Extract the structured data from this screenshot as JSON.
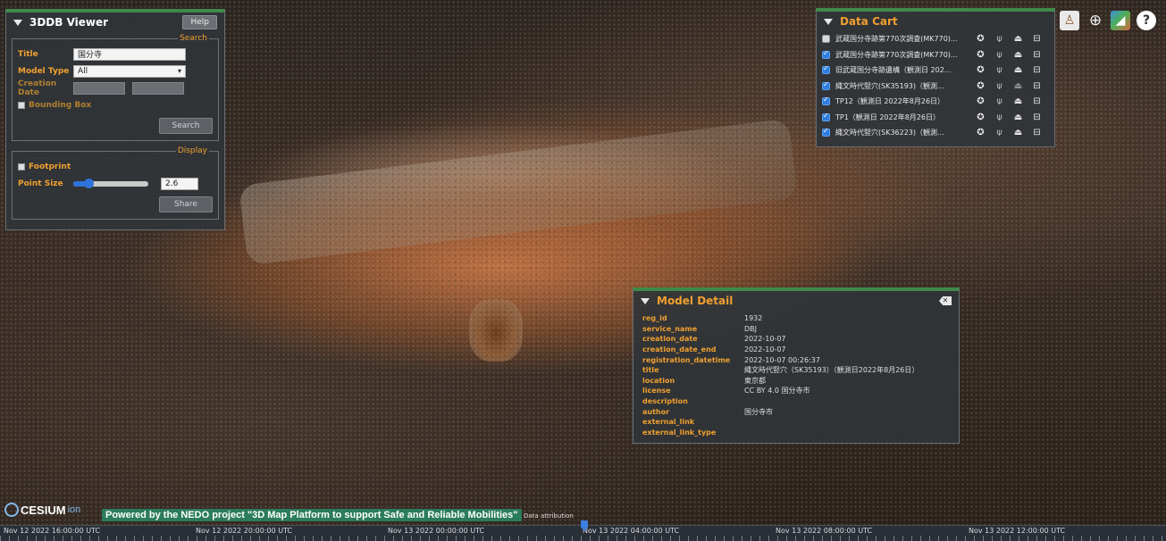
{
  "viewer": {
    "title": "3DDB Viewer",
    "help_label": "Help",
    "search": {
      "legend": "Search",
      "title_label": "Title",
      "title_value": "国分寺",
      "model_type_label": "Model Type",
      "model_type_value": "All",
      "creation_date_label": "Creation Date",
      "bounding_box_label": "Bounding Box",
      "search_button": "Search"
    },
    "display": {
      "legend": "Display",
      "footprint_label": "Footprint",
      "point_size_label": "Point Size",
      "point_size_value": "2.6",
      "point_size_fraction": 0.2,
      "share_button": "Share"
    }
  },
  "cart": {
    "title": "Data Cart",
    "items": [
      {
        "label": "武蔵国分寺跡第770次調査(MK770)...",
        "checked": false
      },
      {
        "label": "武蔵国分寺跡第770次調査(MK770)...",
        "checked": true
      },
      {
        "label": "旧武蔵国分寺跡遺構（観測日 202...",
        "checked": true
      },
      {
        "label": "縄文時代竪穴(SK35193)（観測...",
        "checked": true
      },
      {
        "label": "TP12（観測日 2022年8月26日）",
        "checked": true
      },
      {
        "label": "TP1（観測日 2022年8月26日）",
        "checked": true
      },
      {
        "label": "縄文時代竪穴(SK36223)（観測...",
        "checked": true
      }
    ]
  },
  "detail": {
    "title": "Model Detail",
    "fields": [
      {
        "key": "reg_id",
        "value": "1932"
      },
      {
        "key": "service_name",
        "value": "DBJ"
      },
      {
        "key": "creation_date",
        "value": "2022-10-07"
      },
      {
        "key": "creation_date_end",
        "value": "2022-10-07"
      },
      {
        "key": "registration_datetime",
        "value": "2022-10-07 00:26:37"
      },
      {
        "key": "title",
        "value": "縄文時代竪穴（SK35193）（観測日2022年8月26日）"
      },
      {
        "key": "location",
        "value": "東京都"
      },
      {
        "key": "license",
        "value": "CC BY 4.0 国分寺市"
      },
      {
        "key": "description",
        "value": ""
      },
      {
        "key": "author",
        "value": "国分寺市"
      },
      {
        "key": "external_link",
        "value": ""
      },
      {
        "key": "external_link_type",
        "value": ""
      }
    ]
  },
  "bottom": {
    "cesium_text": "CESIUM",
    "cesium_ion": "ion",
    "nedo": "Powered by the NEDO project \"3D Map Platform to support Safe and Reliable Mobilities\"",
    "attribution": "Data attribution"
  },
  "timeline": {
    "labels": [
      "Nov 12 2022 16:00:00 UTC",
      "Nov 12 2022 20:00:00 UTC",
      "Nov 13 2022 00:00:00 UTC",
      "Nov 13 2022 04:00:00 UTC",
      "Nov 13 2022 08:00:00 UTC",
      "Nov 13 2022 12:00:00 UTC"
    ]
  },
  "toolbar": {
    "icons": [
      "pedestrian-icon",
      "globe-icon",
      "map-layers-icon",
      "help-icon"
    ],
    "help_glyph": "?"
  },
  "colors": {
    "accent": "#f0a030",
    "panel_border_top": "#3f8a4a",
    "checkbox_blue": "#2d7de0",
    "nedo_bg": "#2b7c5c"
  }
}
